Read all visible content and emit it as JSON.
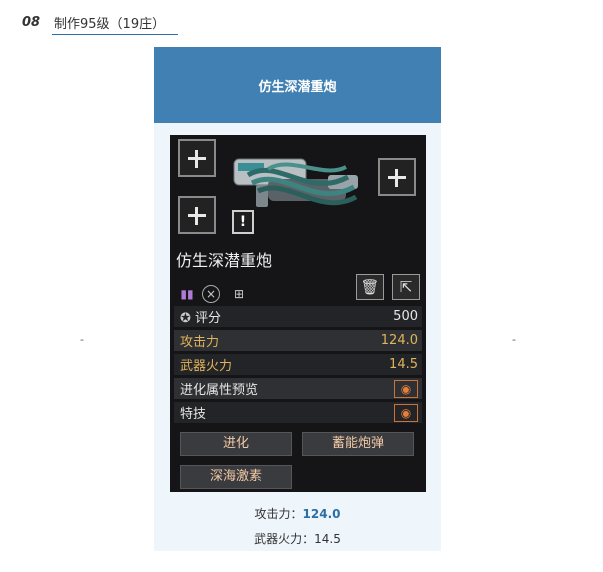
{
  "section": {
    "number": "08",
    "title": "制作95级（19庄）"
  },
  "card": {
    "header": "仿生深潜重炮"
  },
  "game": {
    "weapon_name": "仿生深潜重炮",
    "warning_glyph": "!",
    "stats": [
      {
        "label": "评分",
        "value": "500"
      },
      {
        "label": "攻击力",
        "value": "124.0"
      },
      {
        "label": "武器火力",
        "value": "14.5"
      },
      {
        "label": "进化属性预览",
        "value": ""
      },
      {
        "label": "特技",
        "value": ""
      }
    ],
    "buttons": {
      "evolve": "进化",
      "charge": "蓄能炮弹",
      "deep_sea": "深海激素"
    },
    "colors": {
      "gold": "#e0b45a",
      "eye": "#e5803c"
    }
  },
  "footer": {
    "attack_label": "攻击力：",
    "attack_value": "124.0",
    "firepower_label": "武器火力：",
    "firepower_value": "14.5"
  },
  "side_marks": {
    "left": "-",
    "right": "-"
  }
}
